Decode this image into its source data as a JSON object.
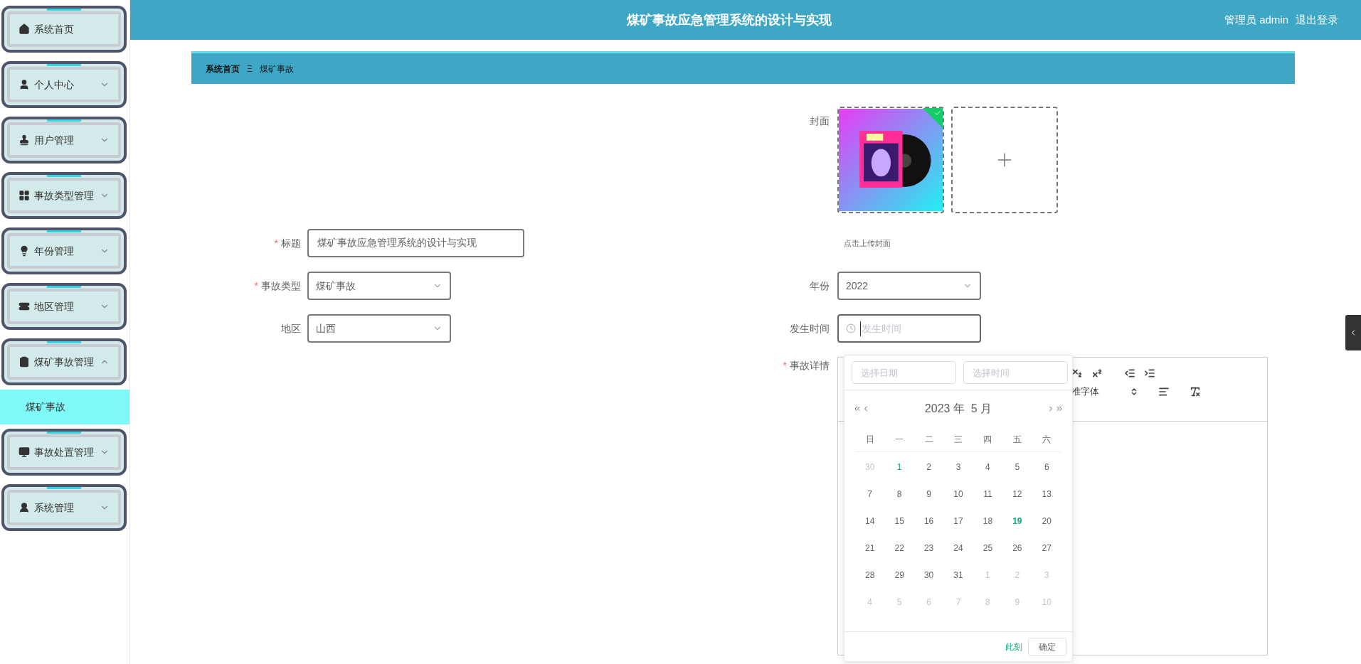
{
  "header": {
    "title": "煤矿事故应急管理系统的设计与实现",
    "user": "管理员 admin",
    "logout": "退出登录"
  },
  "sidebar": {
    "items": [
      {
        "label": "系统首页",
        "kind": "link"
      },
      {
        "label": "个人中心",
        "kind": "menu",
        "expanded": false
      },
      {
        "label": "用户管理",
        "kind": "menu",
        "expanded": false
      },
      {
        "label": "事故类型管理",
        "kind": "menu",
        "expanded": false
      },
      {
        "label": "年份管理",
        "kind": "menu",
        "expanded": false
      },
      {
        "label": "地区管理",
        "kind": "menu",
        "expanded": false
      },
      {
        "label": "煤矿事故管理",
        "kind": "menu",
        "expanded": true,
        "children": [
          {
            "label": "煤矿事故",
            "selected": true
          }
        ]
      },
      {
        "label": "事故处置管理",
        "kind": "menu",
        "expanded": false
      },
      {
        "label": "系统管理",
        "kind": "menu",
        "expanded": false
      }
    ]
  },
  "breadcrumb": {
    "items": [
      "系统首页",
      "煤矿事故"
    ],
    "separator": "Ξ"
  },
  "form": {
    "required_mark": "*",
    "left": [
      {
        "label": "标题",
        "required": true,
        "kind": "text",
        "value": "煤矿事故应急管理系统的设计与实现"
      },
      {
        "label": "事故类型",
        "required": true,
        "kind": "select",
        "value": "煤矿事故"
      },
      {
        "label": "地区",
        "required": false,
        "kind": "select",
        "value": "山西"
      }
    ],
    "cover": {
      "label": "封面",
      "hint": "点击上传封面",
      "uploaded": true
    },
    "right": [
      {
        "label": "年份",
        "required": false,
        "kind": "select",
        "value": "2022"
      },
      {
        "label": "发生时间",
        "required": false,
        "kind": "datetime",
        "placeholder": "发生时间"
      }
    ],
    "details": {
      "label": "事故详情",
      "required": true,
      "font": "准字体"
    }
  },
  "picker": {
    "date_placeholder": "选择日期",
    "time_placeholder": "选择时间",
    "month_label": "2023 年  5 月",
    "weekdays": [
      "日",
      "一",
      "二",
      "三",
      "四",
      "五",
      "六"
    ],
    "days": [
      {
        "day": "30",
        "kind": "other"
      },
      {
        "day": "1",
        "kind": "hover"
      },
      {
        "day": "2",
        "kind": "current"
      },
      {
        "day": "3",
        "kind": "current"
      },
      {
        "day": "4",
        "kind": "current"
      },
      {
        "day": "5",
        "kind": "current"
      },
      {
        "day": "6",
        "kind": "current"
      },
      {
        "day": "7",
        "kind": "current"
      },
      {
        "day": "8",
        "kind": "current"
      },
      {
        "day": "9",
        "kind": "current"
      },
      {
        "day": "10",
        "kind": "current"
      },
      {
        "day": "11",
        "kind": "current"
      },
      {
        "day": "12",
        "kind": "current"
      },
      {
        "day": "13",
        "kind": "current"
      },
      {
        "day": "14",
        "kind": "current"
      },
      {
        "day": "15",
        "kind": "current"
      },
      {
        "day": "16",
        "kind": "current"
      },
      {
        "day": "17",
        "kind": "current"
      },
      {
        "day": "18",
        "kind": "current"
      },
      {
        "day": "19",
        "kind": "today"
      },
      {
        "day": "20",
        "kind": "current"
      },
      {
        "day": "21",
        "kind": "current"
      },
      {
        "day": "22",
        "kind": "current"
      },
      {
        "day": "23",
        "kind": "current"
      },
      {
        "day": "24",
        "kind": "current"
      },
      {
        "day": "25",
        "kind": "current"
      },
      {
        "day": "26",
        "kind": "current"
      },
      {
        "day": "27",
        "kind": "current"
      },
      {
        "day": "28",
        "kind": "current"
      },
      {
        "day": "29",
        "kind": "current"
      },
      {
        "day": "30",
        "kind": "current"
      },
      {
        "day": "31",
        "kind": "current"
      },
      {
        "day": "1",
        "kind": "other"
      },
      {
        "day": "2",
        "kind": "other"
      },
      {
        "day": "3",
        "kind": "other"
      },
      {
        "day": "4",
        "kind": "other"
      },
      {
        "day": "5",
        "kind": "other"
      },
      {
        "day": "6",
        "kind": "other"
      },
      {
        "day": "7",
        "kind": "other"
      },
      {
        "day": "8",
        "kind": "other"
      },
      {
        "day": "9",
        "kind": "other"
      },
      {
        "day": "10",
        "kind": "other"
      }
    ],
    "now": "此刻",
    "confirm": "确定"
  }
}
